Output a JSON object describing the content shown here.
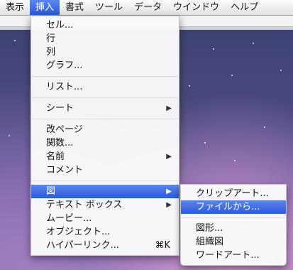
{
  "menubar": [
    "表示",
    "挿入",
    "書式",
    "ツール",
    "データ",
    "ウインドウ",
    "ヘルプ"
  ],
  "insert_menu": {
    "items": [
      {
        "label": "セル..."
      },
      {
        "label": "行"
      },
      {
        "label": "列"
      },
      {
        "label": "グラフ..."
      },
      {
        "separator": true
      },
      {
        "label": "リスト..."
      },
      {
        "separator": true
      },
      {
        "label": "シート",
        "submenu": true
      },
      {
        "separator": true
      },
      {
        "label": "改ページ"
      },
      {
        "label": "関数..."
      },
      {
        "label": "名前",
        "submenu": true
      },
      {
        "label": "コメント"
      },
      {
        "separator": true
      },
      {
        "label": "図",
        "submenu": true,
        "highlighted": true
      },
      {
        "label": "テキスト ボックス",
        "submenu": true
      },
      {
        "label": "ムービー..."
      },
      {
        "label": "オブジェクト..."
      },
      {
        "label": "ハイパーリンク...",
        "shortcut": "⌘K"
      }
    ]
  },
  "picture_submenu": {
    "items": [
      {
        "label": "クリップアート..."
      },
      {
        "label": "ファイルから...",
        "highlighted": true
      },
      {
        "separator": true
      },
      {
        "label": "図形..."
      },
      {
        "label": "組織図"
      },
      {
        "label": "ワードアート..."
      }
    ]
  },
  "colors": {
    "highlight": "#3a68e0",
    "menubar": "#efefef"
  },
  "icons": {
    "submenu": "triangle-right-icon"
  }
}
